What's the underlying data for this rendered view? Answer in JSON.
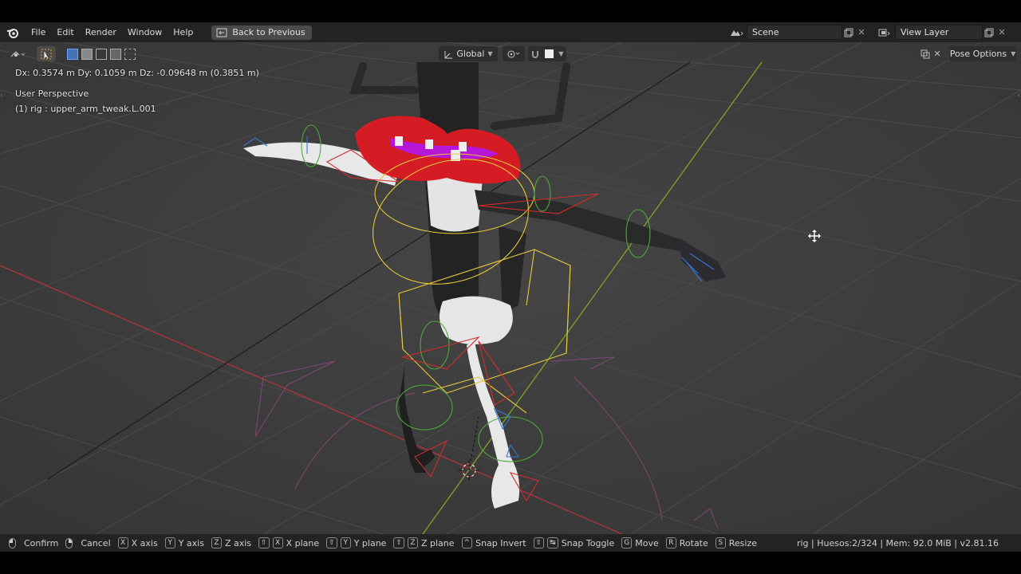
{
  "topbar": {
    "menu": [
      "File",
      "Edit",
      "Render",
      "Window",
      "Help"
    ],
    "back_button": "Back to Previous",
    "scene_label": "Scene",
    "view_layer_label": "View Layer"
  },
  "viewport_header": {
    "transform_orientation": "Global",
    "pose_options": "Pose Options"
  },
  "overlay": {
    "transform_readout": "Dx: 0.3574 m   Dy: 0.1059 m   Dz: -0.09648 m (0.3851 m)",
    "view_name": "User Perspective",
    "active_object": "(1) rig : upper_arm_tweak.L.001"
  },
  "statusbar": {
    "confirm": "Confirm",
    "cancel": "Cancel",
    "x_axis_key": "X",
    "x_axis": "X axis",
    "y_axis_key": "Y",
    "y_axis": "Y axis",
    "z_axis_key": "Z",
    "z_axis": "Z axis",
    "x_plane": "X plane",
    "y_plane": "Y plane",
    "z_plane": "Z plane",
    "snap_invert": "Snap Invert",
    "snap_toggle": "Snap Toggle",
    "move_key": "G",
    "move": "Move",
    "rotate_key": "R",
    "rotate": "Rotate",
    "resize_key": "S",
    "resize": "Resize",
    "info": "rig | Huesos:2/324 | Mem: 92.0 MiB | v2.81.16"
  },
  "colors": {
    "viewport_bg": "#3d3d3d",
    "x_axis_line": "#b0343f",
    "y_axis_line": "#7ea52a",
    "lips": "#d51c24",
    "selected_bone": "#e4c93a"
  }
}
